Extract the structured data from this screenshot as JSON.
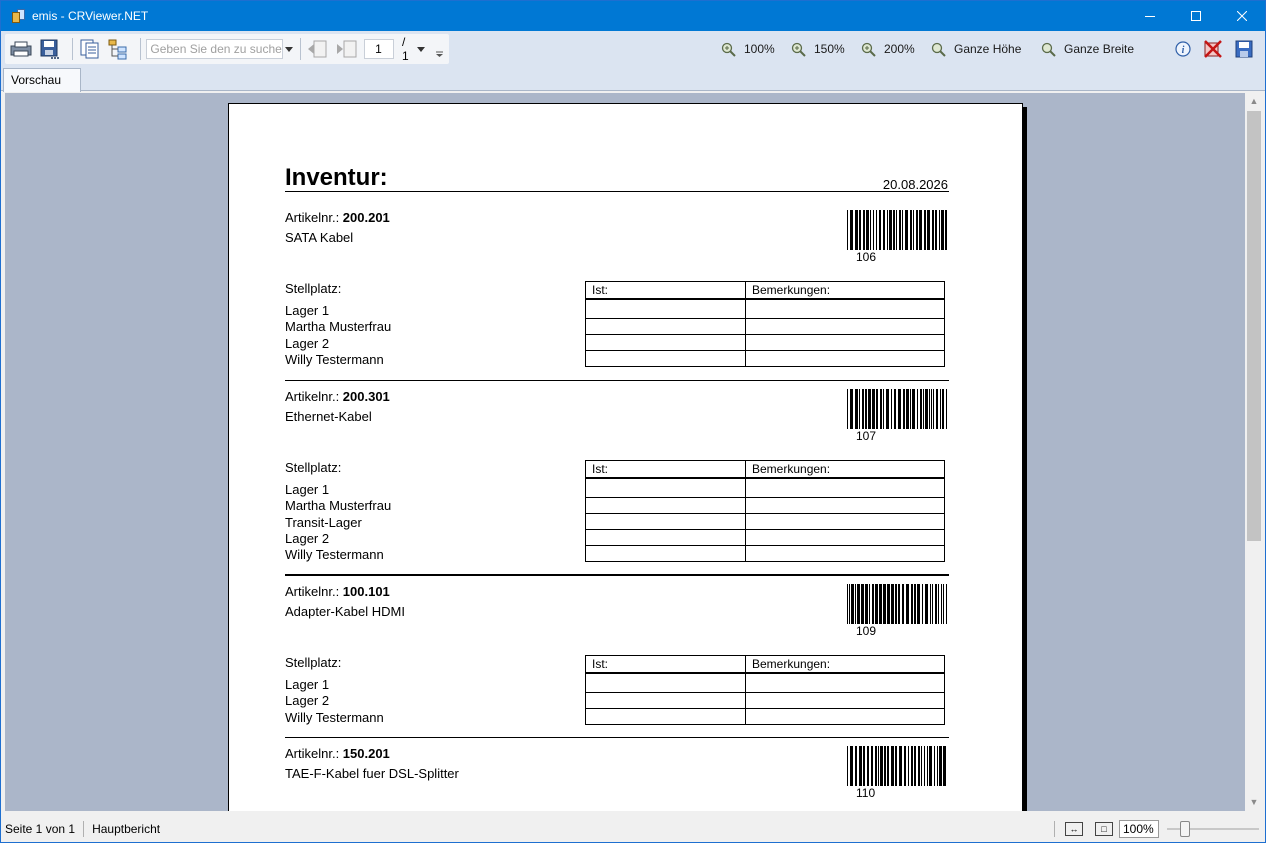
{
  "window": {
    "title": "emis - CRViewer.NET"
  },
  "toolbar": {
    "search_placeholder": "Geben Sie den zu suchen",
    "page_current": "1",
    "page_total": "/ 1",
    "zoom_100": "100%",
    "zoom_150": "150%",
    "zoom_200": "200%",
    "fit_height": "Ganze Höhe",
    "fit_width": "Ganze Breite"
  },
  "tabs": {
    "preview": "Vorschau"
  },
  "report": {
    "title": "Inventur:",
    "date": "20.08.2026",
    "label_article": "Artikelnr.: ",
    "label_location": "Stellplatz:",
    "col_actual": "Ist:",
    "col_remarks": "Bemerkungen:",
    "articles": [
      {
        "number": "200.201",
        "name": "SATA Kabel",
        "barcode": "106",
        "locations": [
          "Lager 1",
          "Martha Musterfrau",
          "Lager 2",
          "Willy Testermann"
        ]
      },
      {
        "number": "200.301",
        "name": "Ethernet-Kabel",
        "barcode": "107",
        "locations": [
          "Lager 1",
          "Martha Musterfrau",
          "Transit-Lager",
          "Lager 2",
          "Willy Testermann"
        ]
      },
      {
        "number": "100.101",
        "name": "Adapter-Kabel HDMI",
        "barcode": "109",
        "locations": [
          "Lager 1",
          "Lager 2",
          "Willy Testermann"
        ]
      },
      {
        "number": "150.201",
        "name": "TAE-F-Kabel fuer DSL-Splitter",
        "barcode": "110",
        "locations": []
      }
    ]
  },
  "status": {
    "page": "Seite 1 von 1",
    "report_name": "Hauptbericht",
    "zoom": "100%"
  }
}
